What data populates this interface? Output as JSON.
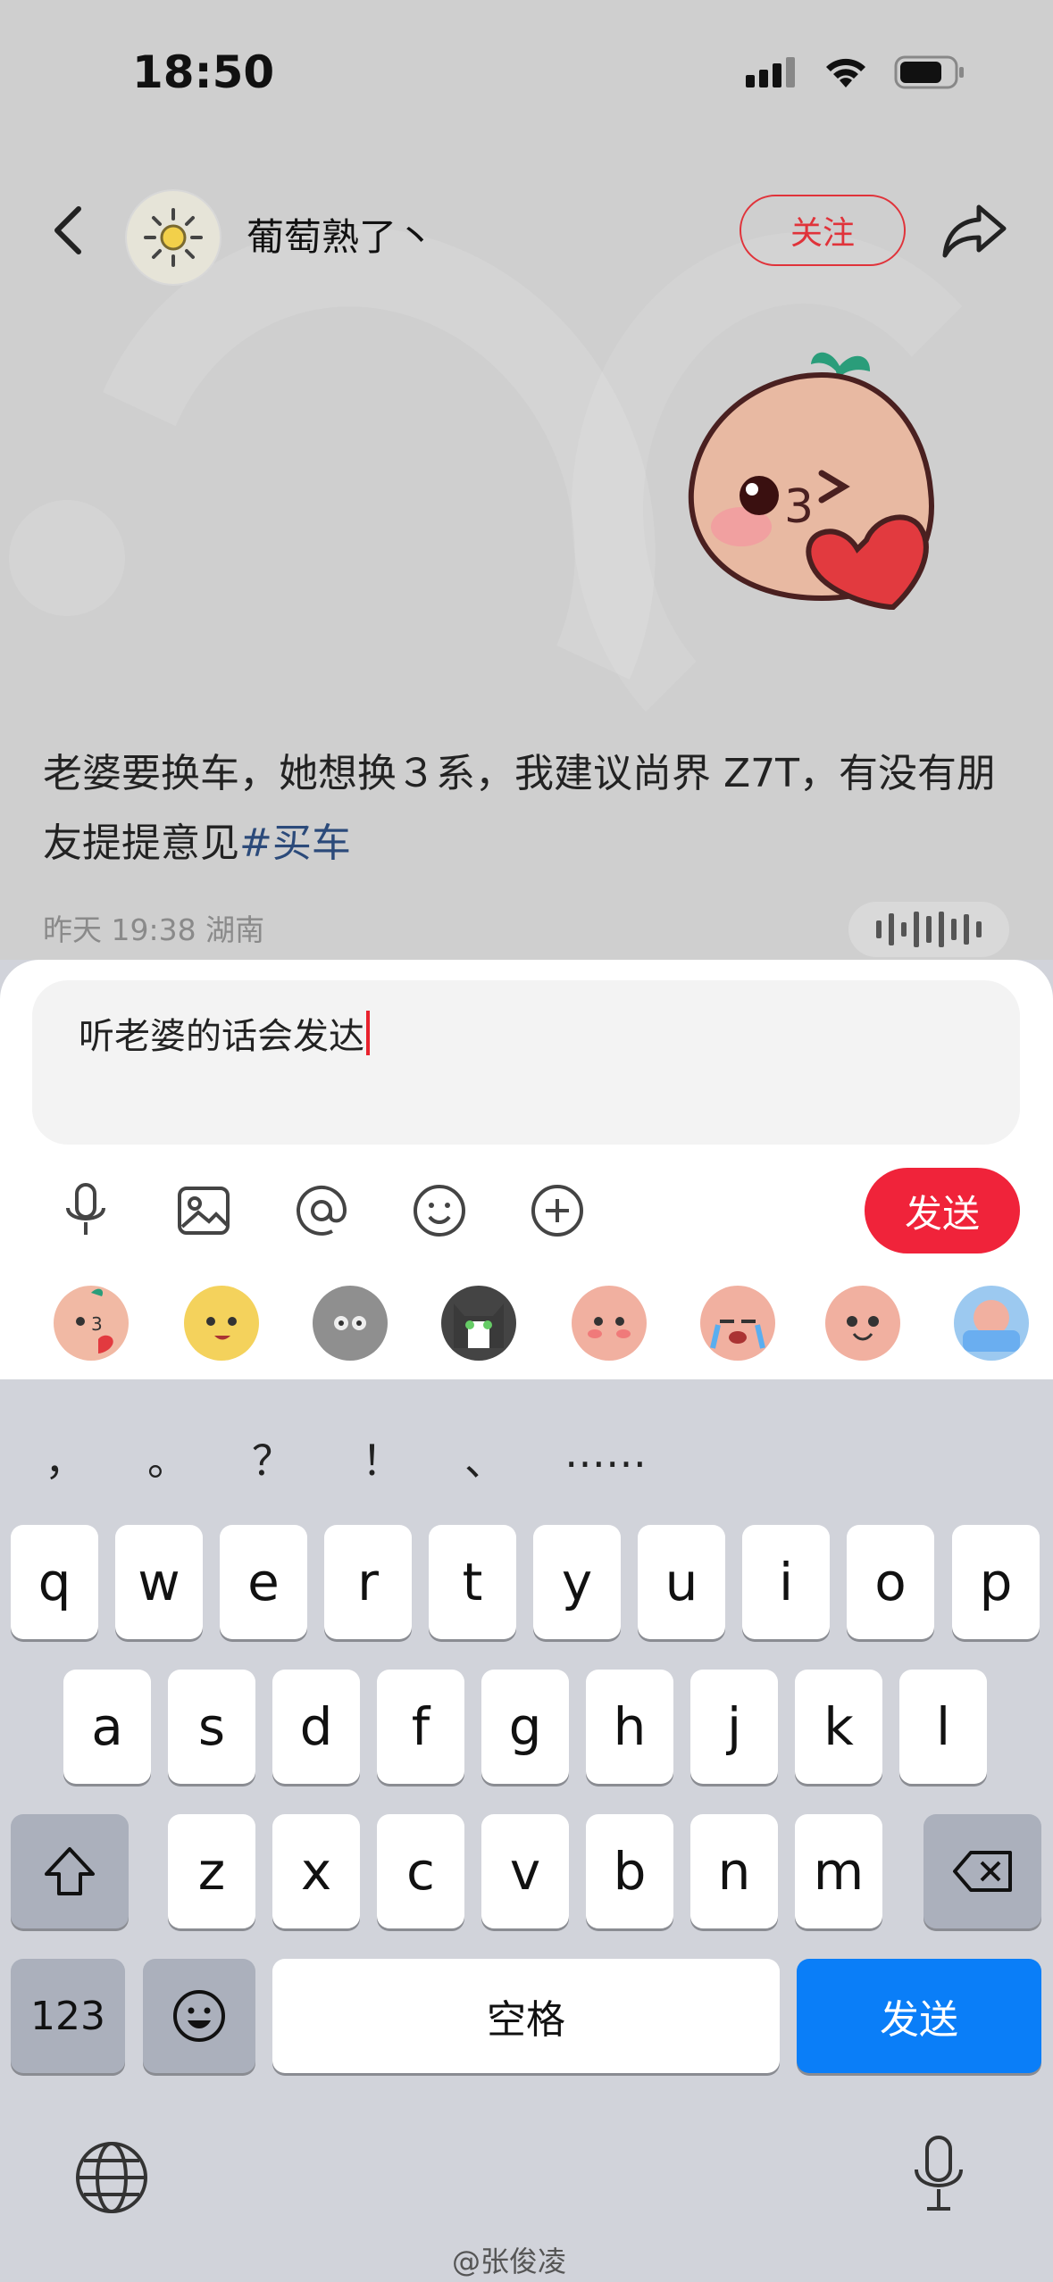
{
  "status_bar": {
    "time": "18:50"
  },
  "header": {
    "username": "葡萄熟了丶",
    "follow_label": "关注"
  },
  "post": {
    "text": "老婆要换车，她想换３系，我建议尚界 Z7T，有没有朋友提提意见",
    "hashtag": "#买车",
    "meta": "昨天 19:38 湖南"
  },
  "comment": {
    "input_value": "听老婆的话会发达",
    "send_label": "发送"
  },
  "toolbar": {
    "icons": [
      "microphone-icon",
      "image-icon",
      "mention-icon",
      "emoji-icon",
      "plus-icon"
    ]
  },
  "stickers": [
    "kiss-peach",
    "yellow-blob",
    "gray-blob",
    "cat",
    "shy-peach",
    "cry-peach",
    "happy-peach",
    "bath-peach"
  ],
  "keyboard": {
    "punctuation": [
      "，",
      "。",
      "？",
      "！",
      "、",
      "……"
    ],
    "row1": [
      "q",
      "w",
      "e",
      "r",
      "t",
      "y",
      "u",
      "i",
      "o",
      "p"
    ],
    "row2": [
      "a",
      "s",
      "d",
      "f",
      "g",
      "h",
      "j",
      "k",
      "l"
    ],
    "row3": [
      "z",
      "x",
      "c",
      "v",
      "b",
      "n",
      "m"
    ],
    "numbers_label": "123",
    "space_label": "空格",
    "send_label": "发送"
  },
  "watermark": "@张俊凌"
}
